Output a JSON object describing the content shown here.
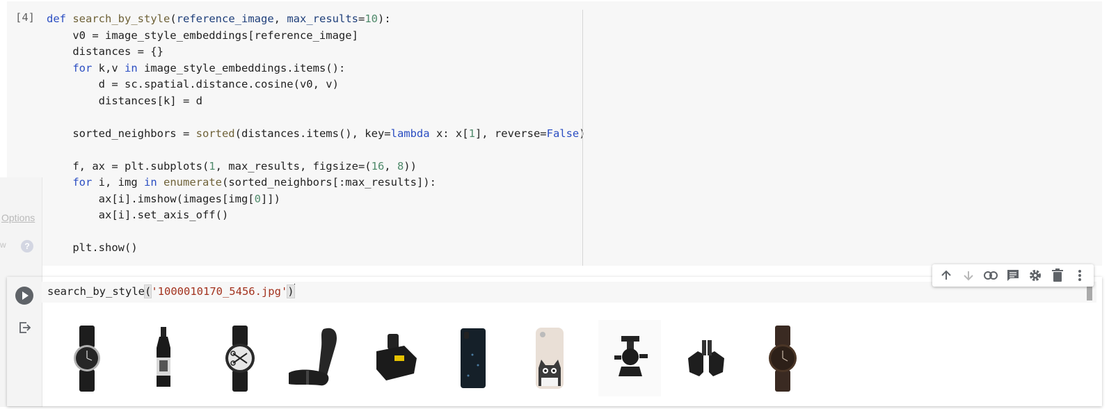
{
  "cell1": {
    "execution_count": "[4]",
    "code_lines": [
      "def search_by_style(reference_image, max_results=10):",
      "    v0 = image_style_embeddings[reference_image]",
      "    distances = {}",
      "    for k,v in image_style_embeddings.items():",
      "        d = sc.spatial.distance.cosine(v0, v)",
      "        distances[k] = d",
      "",
      "    sorted_neighbors = sorted(distances.items(), key=lambda x: x[1], reverse=False)",
      "",
      "    f, ax = plt.subplots(1, max_results, figsize=(16, 8))",
      "    for i, img in enumerate(sorted_neighbors[:max_results]):",
      "        ax[i].imshow(images[img[0]])",
      "        ax[i].set_axis_off()",
      "",
      "    plt.show()"
    ]
  },
  "side_panel": {
    "options_link": "Options",
    "left_fragment": "w",
    "help_icon": "help-icon"
  },
  "cell2": {
    "code_func": "search_by_style",
    "code_open": "(",
    "code_arg": "'1000010170_5456.jpg'",
    "code_close": ")",
    "run_icon": "play-icon",
    "output_icon": "output-redirect-icon"
  },
  "toolbar": {
    "icons": [
      "arrow-up-icon",
      "arrow-down-icon",
      "link-icon",
      "comment-icon",
      "gear-icon",
      "trash-icon",
      "more-vert-icon"
    ]
  },
  "output": {
    "images": [
      "watch-black-leather",
      "bottle-dark-rum",
      "watch-scissors-dial",
      "bicycle-grip",
      "drill-battery",
      "phone-case-dark",
      "phone-case-cat",
      "camera-ball-head",
      "tripod-clamps",
      "watch-brown-leather"
    ]
  }
}
